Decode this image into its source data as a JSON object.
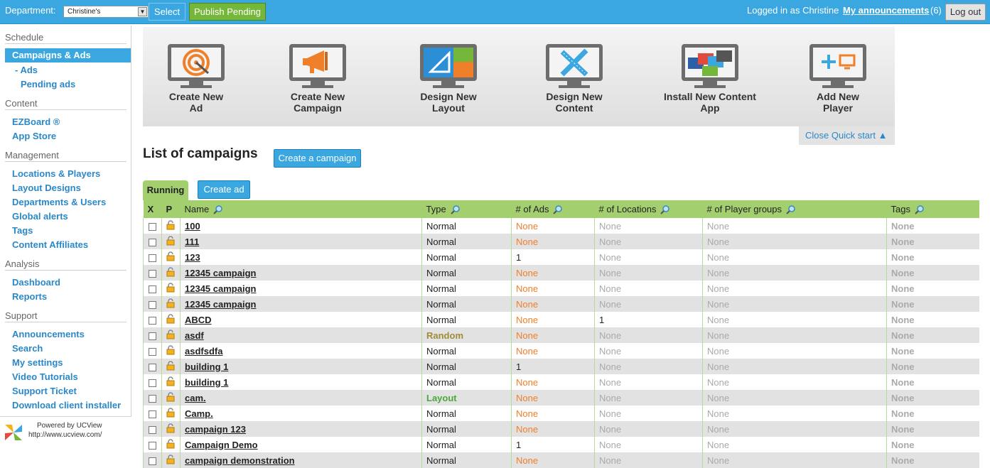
{
  "topbar": {
    "department_label": "Department:",
    "department_value": "Christine's",
    "select_label": "Select",
    "publish_label": "Publish Pending",
    "logged_in_text": "Logged in as Christine",
    "announcements_label": "My announcements",
    "announcements_count": "(6)",
    "logout_label": "Log out"
  },
  "sidebar": {
    "schedule": "Schedule",
    "campaigns_ads": "Campaigns & Ads",
    "ads": "- Ads",
    "pending_ads": "Pending ads",
    "content": "Content",
    "ezboard": "EZBoard ®",
    "app_store": "App Store",
    "management": "Management",
    "locations_players": "Locations & Players",
    "layout_designs": "Layout Designs",
    "departments_users": "Departments & Users",
    "global_alerts": "Global alerts",
    "tags": "Tags",
    "content_affiliates": "Content Affiliates",
    "analysis": "Analysis",
    "dashboard": "Dashboard",
    "reports": "Reports",
    "support": "Support",
    "announcements": "Announcements",
    "search": "Search",
    "my_settings": "My settings",
    "video_tutorials": "Video Tutorials",
    "support_ticket": "Support Ticket",
    "download_installer": "Download client installer",
    "powered_by": "Powered by UCView",
    "powered_url": "http://www.ucview.com/"
  },
  "quickstart": {
    "items": [
      {
        "line1": "Create New",
        "line2": "Ad",
        "icon": "target-icon"
      },
      {
        "line1": "Create New",
        "line2": "Campaign",
        "icon": "megaphone-icon"
      },
      {
        "line1": "Design New",
        "line2": "Layout",
        "icon": "layout-icon"
      },
      {
        "line1": "Design New",
        "line2": "Content",
        "icon": "ruler-pencil-icon"
      },
      {
        "line1": "Install New Content",
        "line2": "App",
        "icon": "app-screens-icon"
      },
      {
        "line1": "Add New",
        "line2": "Player",
        "icon": "add-player-icon"
      }
    ],
    "close_label": "Close Quick start ▲"
  },
  "list": {
    "title": "List of campaigns",
    "create_campaign_label": "Create a campaign",
    "tab_running": "Running",
    "create_ad_label": "Create ad",
    "columns": {
      "x": "X",
      "p": "P",
      "name": "Name",
      "type": "Type",
      "ads": "# of Ads",
      "locations": "# of Locations",
      "player_groups": "# of Player groups",
      "tags": "Tags"
    },
    "rows": [
      {
        "name": "100",
        "type": "Normal",
        "ads": "None",
        "locations": "None",
        "groups": "None",
        "tags": "None"
      },
      {
        "name": "111",
        "type": "Normal",
        "ads": "None",
        "locations": "None",
        "groups": "None",
        "tags": "None"
      },
      {
        "name": "123",
        "type": "Normal",
        "ads": "1",
        "locations": "None",
        "groups": "None",
        "tags": "None"
      },
      {
        "name": "12345 campaign",
        "type": "Normal",
        "ads": "None",
        "locations": "None",
        "groups": "None",
        "tags": "None"
      },
      {
        "name": "12345 campaign",
        "type": "Normal",
        "ads": "None",
        "locations": "None",
        "groups": "None",
        "tags": "None"
      },
      {
        "name": "12345 campaign",
        "type": "Normal",
        "ads": "None",
        "locations": "None",
        "groups": "None",
        "tags": "None"
      },
      {
        "name": "ABCD",
        "type": "Normal",
        "ads": "None",
        "locations": "1",
        "groups": "None",
        "tags": "None"
      },
      {
        "name": "asdf",
        "type": "Random",
        "ads": "None",
        "locations": "None",
        "groups": "None",
        "tags": "None"
      },
      {
        "name": "asdfsdfa",
        "type": "Normal",
        "ads": "None",
        "locations": "None",
        "groups": "None",
        "tags": "None"
      },
      {
        "name": "building 1",
        "type": "Normal",
        "ads": "1",
        "locations": "None",
        "groups": "None",
        "tags": "None"
      },
      {
        "name": "building 1",
        "type": "Normal",
        "ads": "None",
        "locations": "None",
        "groups": "None",
        "tags": "None"
      },
      {
        "name": "cam.",
        "type": "Layout",
        "ads": "None",
        "locations": "None",
        "groups": "None",
        "tags": "None"
      },
      {
        "name": "Camp.",
        "type": "Normal",
        "ads": "None",
        "locations": "None",
        "groups": "None",
        "tags": "None"
      },
      {
        "name": "campaign 123",
        "type": "Normal",
        "ads": "None",
        "locations": "None",
        "groups": "None",
        "tags": "None"
      },
      {
        "name": "Campaign Demo",
        "type": "Normal",
        "ads": "1",
        "locations": "None",
        "groups": "None",
        "tags": "None"
      },
      {
        "name": "campaign demonstration",
        "type": "Normal",
        "ads": "None",
        "locations": "None",
        "groups": "None",
        "tags": "None"
      }
    ]
  },
  "colors": {
    "topbar": "#3aa7e0",
    "publish": "#74b73a",
    "table_header": "#a3cf6e",
    "link": "#2a88c8",
    "none_orange": "#f07f2a"
  }
}
